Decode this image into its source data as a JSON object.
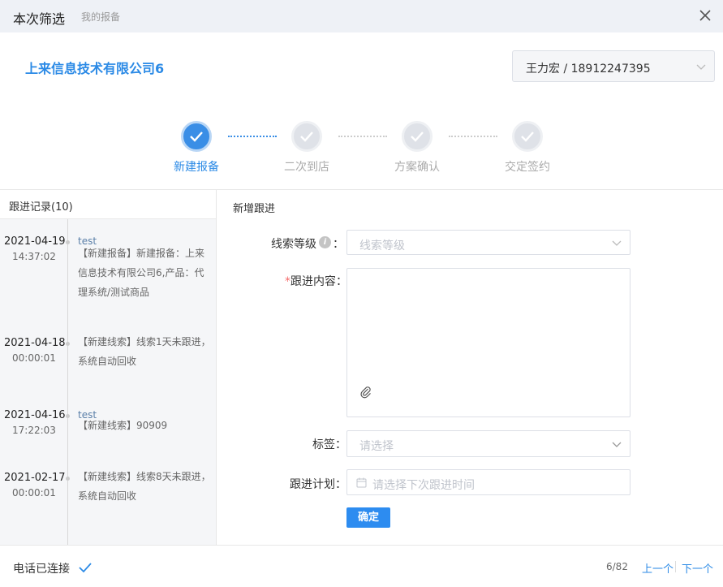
{
  "header": {
    "title": "本次筛选",
    "subtitle": "我的报备"
  },
  "company": {
    "name": "上来信息技术有限公司6"
  },
  "contact": {
    "selected": "王力宏 / 18912247395"
  },
  "steps": [
    {
      "label": "新建报备",
      "state": "active"
    },
    {
      "label": "二次到店",
      "state": "inactive"
    },
    {
      "label": "方案确认",
      "state": "inactive"
    },
    {
      "label": "交定签约",
      "state": "inactive"
    }
  ],
  "records": {
    "title": "跟进记录(10)",
    "entries": [
      {
        "date": "2021-04-19",
        "time": "14:37:02",
        "who": "test",
        "text": "【新建报备】新建报备：上来信息技术有限公司6,产品：代理系统/测试商品"
      },
      {
        "date": "2021-04-18",
        "time": "00:00:01",
        "who": "",
        "text": "【新建线索】线索1天未跟进，系统自动回收"
      },
      {
        "date": "2021-04-16",
        "time": "17:22:03",
        "who": "test",
        "text": "【新建线索】90909"
      },
      {
        "date": "2021-02-17",
        "time": "00:00:01",
        "who": "",
        "text": "【新建线索】线索8天未跟进，系统自动回收"
      }
    ]
  },
  "form": {
    "title": "新增跟进",
    "level_label": "线索等级",
    "level_colon": "：",
    "level_placeholder": "线索等级",
    "content_required": "*",
    "content_label": "跟进内容：",
    "tag_label": "标签：",
    "tag_placeholder": "请选择",
    "plan_label": "跟进计划：",
    "plan_placeholder": "请选择下次跟进时间",
    "submit_label": "确定"
  },
  "footer": {
    "status": "电话已连接",
    "page": "6/82",
    "prev": "上一个",
    "next": "下一个"
  },
  "colors": {
    "accent": "#2b8ae6",
    "button": "#2d8cf0",
    "required": "#f56c6c"
  }
}
